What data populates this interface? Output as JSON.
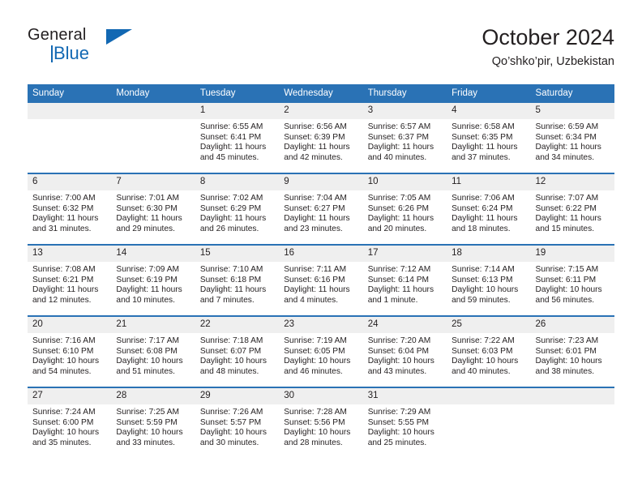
{
  "brand": {
    "name_top": "General",
    "name_bottom": "Blue",
    "accent_color": "#1268b3"
  },
  "header": {
    "title": "October 2024",
    "subtitle": "Qo’shko’pir, Uzbekistan"
  },
  "theme": {
    "header_blue": "#2a72b5",
    "daynum_gray": "#efefef",
    "text": "#231f20"
  },
  "calendar": {
    "weekday_headers": [
      "Sunday",
      "Monday",
      "Tuesday",
      "Wednesday",
      "Thursday",
      "Friday",
      "Saturday"
    ],
    "weeks": [
      [
        {
          "day": "",
          "sunrise": "",
          "sunset": "",
          "daylight": "",
          "daylight2": ""
        },
        {
          "day": "",
          "sunrise": "",
          "sunset": "",
          "daylight": "",
          "daylight2": ""
        },
        {
          "day": "1",
          "sunrise": "Sunrise: 6:55 AM",
          "sunset": "Sunset: 6:41 PM",
          "daylight": "Daylight: 11 hours",
          "daylight2": "and 45 minutes."
        },
        {
          "day": "2",
          "sunrise": "Sunrise: 6:56 AM",
          "sunset": "Sunset: 6:39 PM",
          "daylight": "Daylight: 11 hours",
          "daylight2": "and 42 minutes."
        },
        {
          "day": "3",
          "sunrise": "Sunrise: 6:57 AM",
          "sunset": "Sunset: 6:37 PM",
          "daylight": "Daylight: 11 hours",
          "daylight2": "and 40 minutes."
        },
        {
          "day": "4",
          "sunrise": "Sunrise: 6:58 AM",
          "sunset": "Sunset: 6:35 PM",
          "daylight": "Daylight: 11 hours",
          "daylight2": "and 37 minutes."
        },
        {
          "day": "5",
          "sunrise": "Sunrise: 6:59 AM",
          "sunset": "Sunset: 6:34 PM",
          "daylight": "Daylight: 11 hours",
          "daylight2": "and 34 minutes."
        }
      ],
      [
        {
          "day": "6",
          "sunrise": "Sunrise: 7:00 AM",
          "sunset": "Sunset: 6:32 PM",
          "daylight": "Daylight: 11 hours",
          "daylight2": "and 31 minutes."
        },
        {
          "day": "7",
          "sunrise": "Sunrise: 7:01 AM",
          "sunset": "Sunset: 6:30 PM",
          "daylight": "Daylight: 11 hours",
          "daylight2": "and 29 minutes."
        },
        {
          "day": "8",
          "sunrise": "Sunrise: 7:02 AM",
          "sunset": "Sunset: 6:29 PM",
          "daylight": "Daylight: 11 hours",
          "daylight2": "and 26 minutes."
        },
        {
          "day": "9",
          "sunrise": "Sunrise: 7:04 AM",
          "sunset": "Sunset: 6:27 PM",
          "daylight": "Daylight: 11 hours",
          "daylight2": "and 23 minutes."
        },
        {
          "day": "10",
          "sunrise": "Sunrise: 7:05 AM",
          "sunset": "Sunset: 6:26 PM",
          "daylight": "Daylight: 11 hours",
          "daylight2": "and 20 minutes."
        },
        {
          "day": "11",
          "sunrise": "Sunrise: 7:06 AM",
          "sunset": "Sunset: 6:24 PM",
          "daylight": "Daylight: 11 hours",
          "daylight2": "and 18 minutes."
        },
        {
          "day": "12",
          "sunrise": "Sunrise: 7:07 AM",
          "sunset": "Sunset: 6:22 PM",
          "daylight": "Daylight: 11 hours",
          "daylight2": "and 15 minutes."
        }
      ],
      [
        {
          "day": "13",
          "sunrise": "Sunrise: 7:08 AM",
          "sunset": "Sunset: 6:21 PM",
          "daylight": "Daylight: 11 hours",
          "daylight2": "and 12 minutes."
        },
        {
          "day": "14",
          "sunrise": "Sunrise: 7:09 AM",
          "sunset": "Sunset: 6:19 PM",
          "daylight": "Daylight: 11 hours",
          "daylight2": "and 10 minutes."
        },
        {
          "day": "15",
          "sunrise": "Sunrise: 7:10 AM",
          "sunset": "Sunset: 6:18 PM",
          "daylight": "Daylight: 11 hours",
          "daylight2": "and 7 minutes."
        },
        {
          "day": "16",
          "sunrise": "Sunrise: 7:11 AM",
          "sunset": "Sunset: 6:16 PM",
          "daylight": "Daylight: 11 hours",
          "daylight2": "and 4 minutes."
        },
        {
          "day": "17",
          "sunrise": "Sunrise: 7:12 AM",
          "sunset": "Sunset: 6:14 PM",
          "daylight": "Daylight: 11 hours",
          "daylight2": "and 1 minute."
        },
        {
          "day": "18",
          "sunrise": "Sunrise: 7:14 AM",
          "sunset": "Sunset: 6:13 PM",
          "daylight": "Daylight: 10 hours",
          "daylight2": "and 59 minutes."
        },
        {
          "day": "19",
          "sunrise": "Sunrise: 7:15 AM",
          "sunset": "Sunset: 6:11 PM",
          "daylight": "Daylight: 10 hours",
          "daylight2": "and 56 minutes."
        }
      ],
      [
        {
          "day": "20",
          "sunrise": "Sunrise: 7:16 AM",
          "sunset": "Sunset: 6:10 PM",
          "daylight": "Daylight: 10 hours",
          "daylight2": "and 54 minutes."
        },
        {
          "day": "21",
          "sunrise": "Sunrise: 7:17 AM",
          "sunset": "Sunset: 6:08 PM",
          "daylight": "Daylight: 10 hours",
          "daylight2": "and 51 minutes."
        },
        {
          "day": "22",
          "sunrise": "Sunrise: 7:18 AM",
          "sunset": "Sunset: 6:07 PM",
          "daylight": "Daylight: 10 hours",
          "daylight2": "and 48 minutes."
        },
        {
          "day": "23",
          "sunrise": "Sunrise: 7:19 AM",
          "sunset": "Sunset: 6:05 PM",
          "daylight": "Daylight: 10 hours",
          "daylight2": "and 46 minutes."
        },
        {
          "day": "24",
          "sunrise": "Sunrise: 7:20 AM",
          "sunset": "Sunset: 6:04 PM",
          "daylight": "Daylight: 10 hours",
          "daylight2": "and 43 minutes."
        },
        {
          "day": "25",
          "sunrise": "Sunrise: 7:22 AM",
          "sunset": "Sunset: 6:03 PM",
          "daylight": "Daylight: 10 hours",
          "daylight2": "and 40 minutes."
        },
        {
          "day": "26",
          "sunrise": "Sunrise: 7:23 AM",
          "sunset": "Sunset: 6:01 PM",
          "daylight": "Daylight: 10 hours",
          "daylight2": "and 38 minutes."
        }
      ],
      [
        {
          "day": "27",
          "sunrise": "Sunrise: 7:24 AM",
          "sunset": "Sunset: 6:00 PM",
          "daylight": "Daylight: 10 hours",
          "daylight2": "and 35 minutes."
        },
        {
          "day": "28",
          "sunrise": "Sunrise: 7:25 AM",
          "sunset": "Sunset: 5:59 PM",
          "daylight": "Daylight: 10 hours",
          "daylight2": "and 33 minutes."
        },
        {
          "day": "29",
          "sunrise": "Sunrise: 7:26 AM",
          "sunset": "Sunset: 5:57 PM",
          "daylight": "Daylight: 10 hours",
          "daylight2": "and 30 minutes."
        },
        {
          "day": "30",
          "sunrise": "Sunrise: 7:28 AM",
          "sunset": "Sunset: 5:56 PM",
          "daylight": "Daylight: 10 hours",
          "daylight2": "and 28 minutes."
        },
        {
          "day": "31",
          "sunrise": "Sunrise: 7:29 AM",
          "sunset": "Sunset: 5:55 PM",
          "daylight": "Daylight: 10 hours",
          "daylight2": "and 25 minutes."
        },
        {
          "day": "",
          "sunrise": "",
          "sunset": "",
          "daylight": "",
          "daylight2": ""
        },
        {
          "day": "",
          "sunrise": "",
          "sunset": "",
          "daylight": "",
          "daylight2": ""
        }
      ]
    ]
  }
}
